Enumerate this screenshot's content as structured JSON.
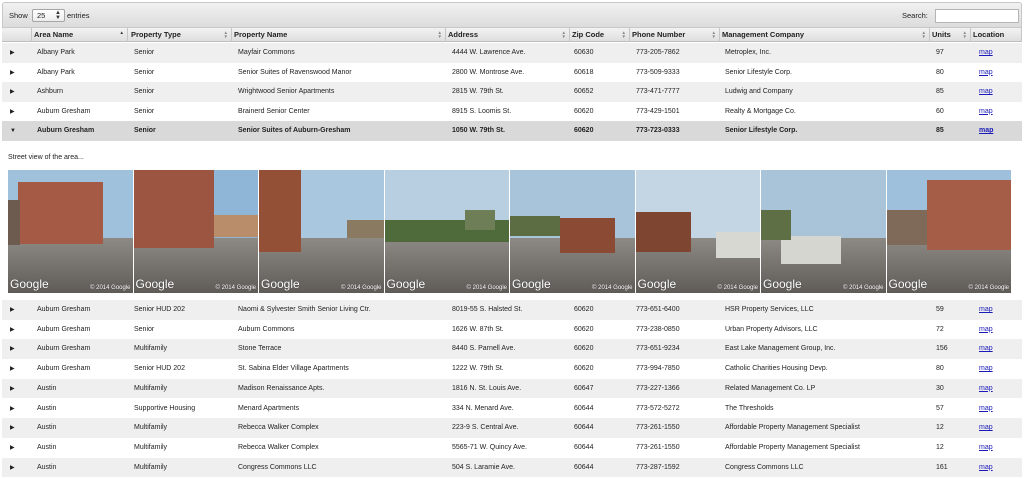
{
  "toolbar": {
    "show_label": "Show",
    "entries_value": "25",
    "entries_label": "entries",
    "search_label": "Search:",
    "search_value": ""
  },
  "columns": [
    {
      "label": "Area Name",
      "sorted": true
    },
    {
      "label": "Property Type",
      "sorted": false
    },
    {
      "label": "Property Name",
      "sorted": false
    },
    {
      "label": "Address",
      "sorted": false
    },
    {
      "label": "Zip Code",
      "sorted": false
    },
    {
      "label": "Phone Number",
      "sorted": false
    },
    {
      "label": "Management Company",
      "sorted": false
    },
    {
      "label": "Units",
      "sorted": false
    },
    {
      "label": "Location",
      "sorted": false
    }
  ],
  "rows_top": [
    {
      "area": "Albany Park",
      "type": "Senior",
      "name": "Mayfair Commons",
      "address": "4444 W. Lawrence Ave.",
      "zip": "60630",
      "phone": "773-205-7862",
      "company": "Metroplex, Inc.",
      "units": "97",
      "location": "map"
    },
    {
      "area": "Albany Park",
      "type": "Senior",
      "name": "Senior Suites of Ravenswood Manor",
      "address": "2800 W. Montrose Ave.",
      "zip": "60618",
      "phone": "773-509-9333",
      "company": "Senior Lifestyle Corp.",
      "units": "80",
      "location": "map"
    },
    {
      "area": "Ashburn",
      "type": "Senior",
      "name": "Wrightwood Senior Apartments",
      "address": "2815 W. 79th St.",
      "zip": "60652",
      "phone": "773-471-7777",
      "company": "Ludwig and Company",
      "units": "85",
      "location": "map"
    },
    {
      "area": "Auburn Gresham",
      "type": "Senior",
      "name": "Brainerd Senior Center",
      "address": "8915 S. Loomis St.",
      "zip": "60620",
      "phone": "773-429-1501",
      "company": "Realty & Mortgage Co.",
      "units": "60",
      "location": "map"
    },
    {
      "area": "Auburn Gresham",
      "type": "Senior",
      "name": "Senior Suites of Auburn-Gresham",
      "address": "1050 W. 79th St.",
      "zip": "60620",
      "phone": "773-723-0333",
      "company": "Senior Lifestyle Corp.",
      "units": "85",
      "location": "map",
      "expanded": true
    }
  ],
  "detail": {
    "caption": "Street view of the area...",
    "photos": [
      {
        "logo": "Google",
        "copyright": "© 2014 Google"
      },
      {
        "logo": "Google",
        "copyright": "© 2014 Google"
      },
      {
        "logo": "Google",
        "copyright": "© 2014 Google"
      },
      {
        "logo": "Google",
        "copyright": "© 2014 Google"
      },
      {
        "logo": "Google",
        "copyright": "© 2014 Google"
      },
      {
        "logo": "Google",
        "copyright": "© 2014 Google"
      },
      {
        "logo": "Google",
        "copyright": "© 2014 Google"
      },
      {
        "logo": "Google",
        "copyright": "© 2014 Google"
      }
    ]
  },
  "rows_bottom": [
    {
      "area": "Auburn Gresham",
      "type": "Senior HUD 202",
      "name": "Naomi & Sylvester Smith Senior Living Ctr.",
      "address": "8019-55 S. Halsted St.",
      "zip": "60620",
      "phone": "773-651-6400",
      "company": "HSR Property Services, LLC",
      "units": "59",
      "location": "map"
    },
    {
      "area": "Auburn Gresham",
      "type": "Senior",
      "name": "Auburn Commons",
      "address": "1626 W. 87th St.",
      "zip": "60620",
      "phone": "773-238-0850",
      "company": "Urban Property Advisors, LLC",
      "units": "72",
      "location": "map"
    },
    {
      "area": "Auburn Gresham",
      "type": "Multifamily",
      "name": "Stone Terrace",
      "address": "8440 S. Parnell Ave.",
      "zip": "60620",
      "phone": "773-651-9234",
      "company": "East Lake Management Group, Inc.",
      "units": "156",
      "location": "map"
    },
    {
      "area": "Auburn Gresham",
      "type": "Senior HUD 202",
      "name": "St. Sabina Elder Village Apartments",
      "address": "1222 W. 79th St.",
      "zip": "60620",
      "phone": "773-994-7850",
      "company": "Catholic Charities Housing Devp.",
      "units": "80",
      "location": "map"
    },
    {
      "area": "Austin",
      "type": "Multifamily",
      "name": "Madison Renaissance Apts.",
      "address": "1816 N. St. Louis Ave.",
      "zip": "60647",
      "phone": "773-227-1366",
      "company": "Related Management Co. LP",
      "units": "30",
      "location": "map"
    },
    {
      "area": "Austin",
      "type": "Supportive Housing",
      "name": "Menard Apartments",
      "address": "334 N. Menard Ave.",
      "zip": "60644",
      "phone": "773-572-5272",
      "company": "The Thresholds",
      "units": "57",
      "location": "map"
    },
    {
      "area": "Austin",
      "type": "Multifamily",
      "name": "Rebecca Walker Complex",
      "address": "223-9 S. Central Ave.",
      "zip": "60644",
      "phone": "773-261-1550",
      "company": "Affordable Property Management Specialist",
      "units": "12",
      "location": "map"
    },
    {
      "area": "Austin",
      "type": "Multifamily",
      "name": "Rebecca Walker Complex",
      "address": "5565-71 W. Quincy Ave.",
      "zip": "60644",
      "phone": "773-261-1550",
      "company": "Affordable Property Management Specialist",
      "units": "12",
      "location": "map"
    },
    {
      "area": "Austin",
      "type": "Multifamily",
      "name": "Congress Commons LLC",
      "address": "504 S. Laramie Ave.",
      "zip": "60644",
      "phone": "773-287-1592",
      "company": "Congress Commons LLC",
      "units": "161",
      "location": "map"
    }
  ]
}
